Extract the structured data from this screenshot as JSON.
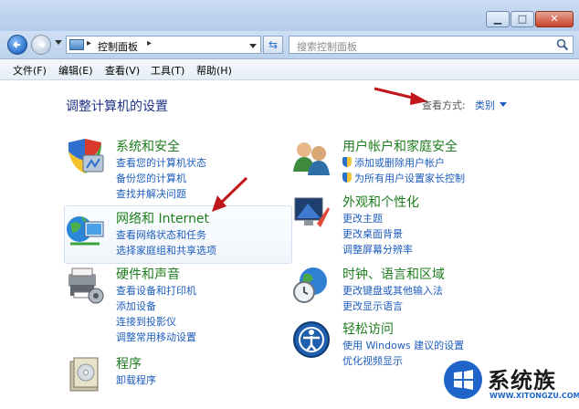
{
  "window": {
    "minimize_glyph": "▁",
    "maximize_glyph": "□",
    "close_glyph": "✕"
  },
  "address_bar": {
    "separator": "▸",
    "location": "控制面板",
    "trailing_separator": "▸"
  },
  "search": {
    "placeholder": "搜索控制面板"
  },
  "menu": {
    "items": [
      {
        "label": "文件(F)"
      },
      {
        "label": "编辑(E)"
      },
      {
        "label": "查看(V)"
      },
      {
        "label": "工具(T)"
      },
      {
        "label": "帮助(H)"
      }
    ]
  },
  "main": {
    "heading": "调整计算机的设置",
    "view_by_label": "查看方式:",
    "view_by_value": "类别"
  },
  "categories": [
    {
      "title": "系统和安全",
      "icon": "system-security-icon",
      "links": [
        "查看您的计算机状态",
        "备份您的计算机",
        "查找并解决问题"
      ]
    },
    {
      "title": "网络和 Internet",
      "icon": "network-internet-icon",
      "links": [
        "查看网络状态和任务",
        "选择家庭组和共享选项"
      ]
    },
    {
      "title": "硬件和声音",
      "icon": "hardware-sound-icon",
      "links": [
        "查看设备和打印机",
        "添加设备",
        "连接到投影仪",
        "调整常用移动设置"
      ]
    },
    {
      "title": "程序",
      "icon": "programs-icon",
      "links": [
        "卸载程序"
      ]
    },
    {
      "title": "用户帐户和家庭安全",
      "icon": "user-accounts-icon",
      "links": [
        "添加或删除用户帐户",
        "为所有用户设置家长控制"
      ]
    },
    {
      "title": "外观和个性化",
      "icon": "appearance-icon",
      "links": [
        "更改主题",
        "更改桌面背景",
        "调整屏幕分辨率"
      ]
    },
    {
      "title": "时钟、语言和区域",
      "icon": "clock-region-icon",
      "links": [
        "更改键盘或其他输入法",
        "更改显示语言"
      ]
    },
    {
      "title": "轻松访问",
      "icon": "ease-of-access-icon",
      "links": [
        "使用 Windows 建议的设置",
        "优化视频显示"
      ]
    }
  ],
  "watermark": {
    "name": "系统族",
    "url": "WWW.XITONGZU.COM"
  },
  "colors": {
    "category_title": "#1e7d1e",
    "link": "#1e5dbd",
    "heading": "#1e3287",
    "annotation_arrow": "#c0171b"
  }
}
